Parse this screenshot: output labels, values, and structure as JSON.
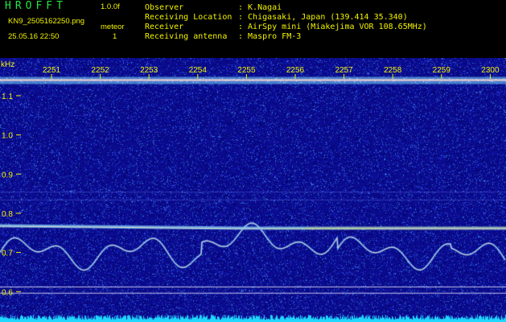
{
  "header": {
    "logo": "HROFFT",
    "version": "1.0.0f",
    "filename": "KN9_2505162250.png",
    "timestamp": "25.05.16 22:50",
    "meteor_label": "meteor",
    "meteor_count": "1"
  },
  "info": {
    "rows": [
      {
        "label": "Observer",
        "value": ": K.Nagai"
      },
      {
        "label": "Receiving Location",
        "value": ": Chigasaki, Japan (139.414 35.340)"
      },
      {
        "label": "Receiver",
        "value": ": AirSpy mini (Miakejima VOR 108.65MHz)"
      },
      {
        "label": "Receiving antenna",
        "value": ": Maspro FM-3"
      }
    ]
  },
  "chart_data": {
    "type": "heatmap",
    "ylabel": "kHz",
    "x_ticks": [
      "2251",
      "2252",
      "2253",
      "2254",
      "2255",
      "2256",
      "2257",
      "2258",
      "2259",
      "2300"
    ],
    "y_ticks": [
      "1.1",
      "1.0",
      "0.9",
      "0.8",
      "0.7",
      "0.6"
    ],
    "ylim": [
      0.58,
      1.18
    ],
    "carrier_khz": 1.14,
    "meteor_trace_khz": 0.762
  },
  "colors": {
    "background": "#0a0a8c",
    "text": "#f2f200",
    "logo": "#22e640"
  }
}
